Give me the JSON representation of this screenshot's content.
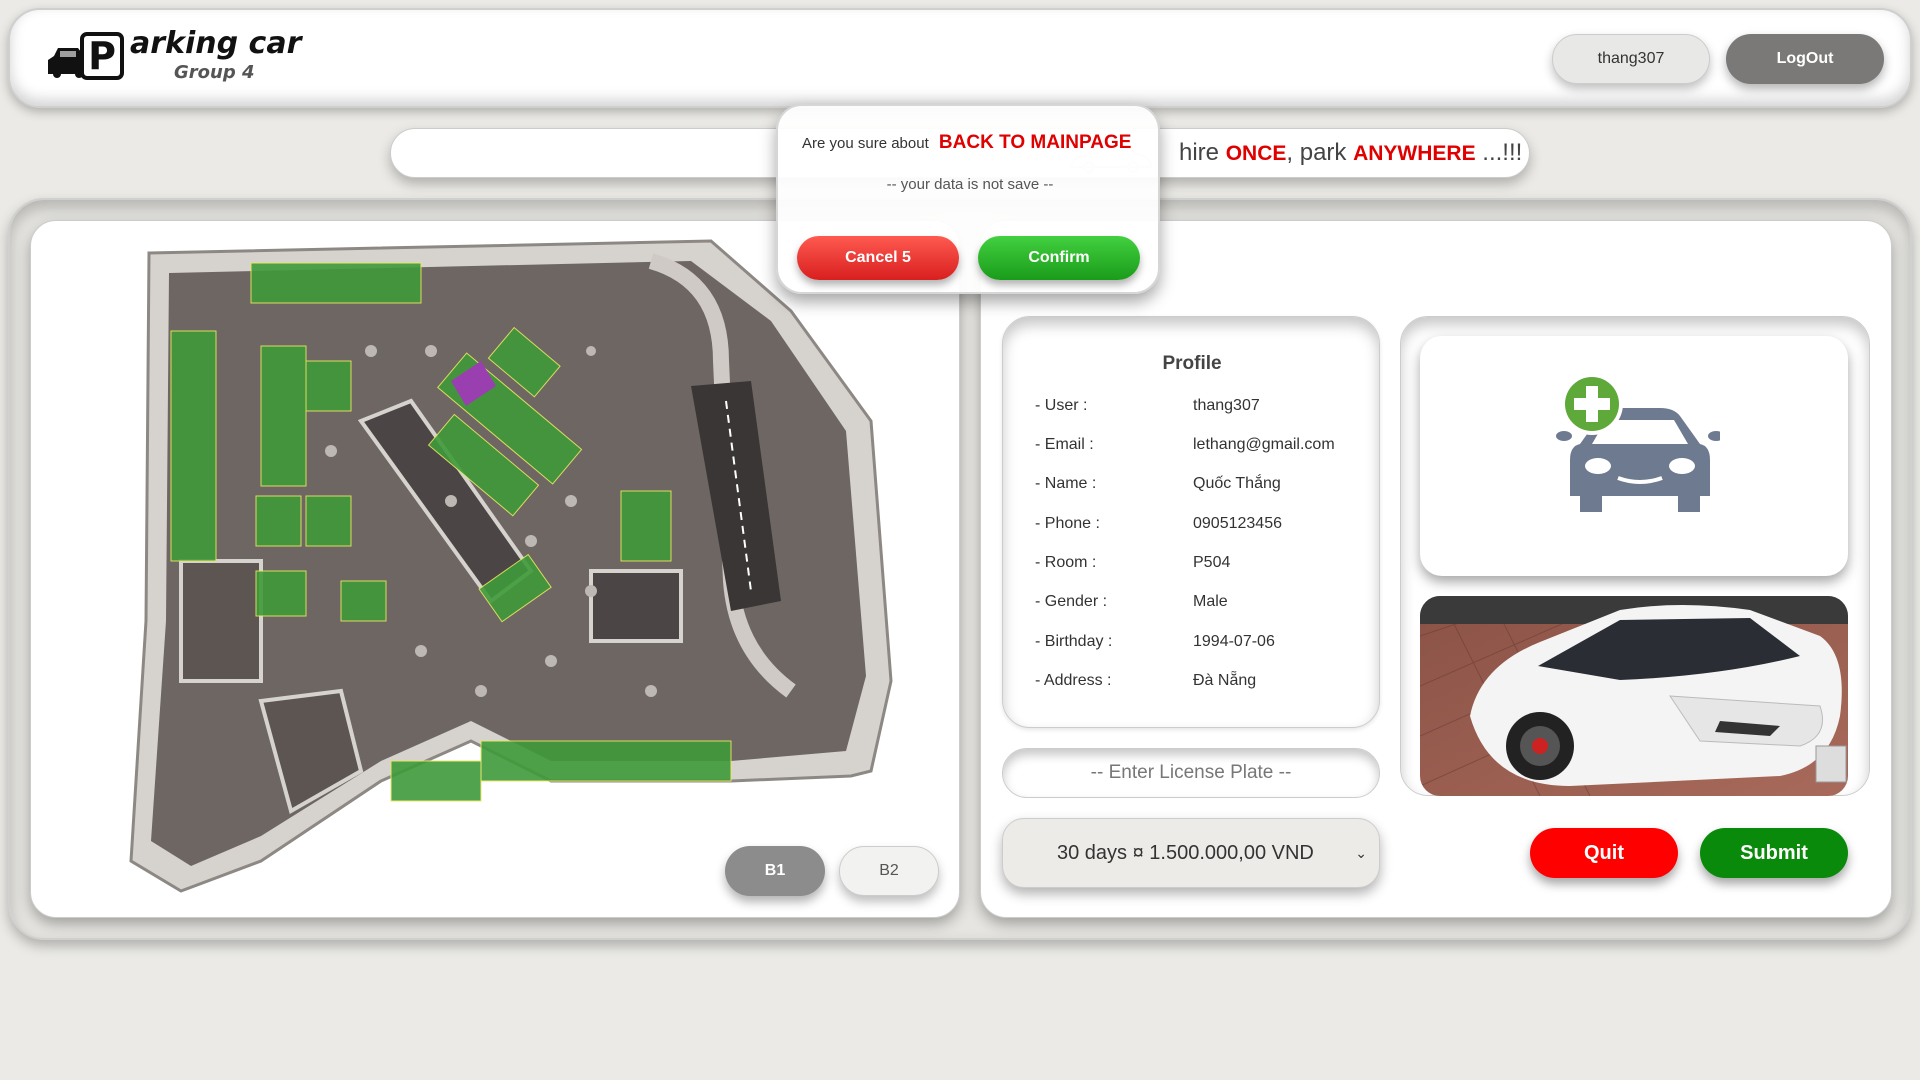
{
  "header": {
    "logo_letter": "P",
    "logo_title": "arking car",
    "logo_subtitle": "Group 4",
    "user_label": "thang307",
    "logout_label": "LogOut"
  },
  "marquee": {
    "hire": "hire",
    "once": "ONCE",
    "park": ", park",
    "anywhere": "ANYWHERE",
    "tail": " ...!!!"
  },
  "dialog": {
    "question": "Are you sure about",
    "target": "BACK TO MAINPAGE",
    "warning": "-- your data is not save --",
    "cancel_label": "Cancel 5",
    "confirm_label": "Confirm"
  },
  "floors": {
    "b1_label": "B1",
    "b2_label": "B2",
    "active": "B1"
  },
  "profile": {
    "title": "Profile",
    "rows": [
      {
        "label": "- User :",
        "value": "thang307"
      },
      {
        "label": "- Email :",
        "value": "lethang@gmail.com"
      },
      {
        "label": "- Name :",
        "value": "Quốc Thắng"
      },
      {
        "label": "- Phone :",
        "value": "0905123456"
      },
      {
        "label": "- Room :",
        "value": "P504"
      },
      {
        "label": "- Gender :",
        "value": "Male"
      },
      {
        "label": "- Birthday :",
        "value": "1994-07-06"
      },
      {
        "label": "- Address :",
        "value": "Đà Nẵng"
      }
    ]
  },
  "form": {
    "plate_placeholder": "-- Enter License Plate --",
    "plan_selected": "30 days ¤ 1.500.000,00 VND",
    "quit_label": "Quit",
    "submit_label": "Submit"
  },
  "icons": {
    "add_car": "add-car-icon",
    "logo_car": "car-silhouette-icon"
  },
  "colors": {
    "accent_red": "#e00000",
    "submit_green": "#0a8a0a",
    "quit_red": "#ff0000",
    "spot_green": "#3f9a3a",
    "spot_purple": "#9a3fb0",
    "map_floor": "#6e6662"
  }
}
